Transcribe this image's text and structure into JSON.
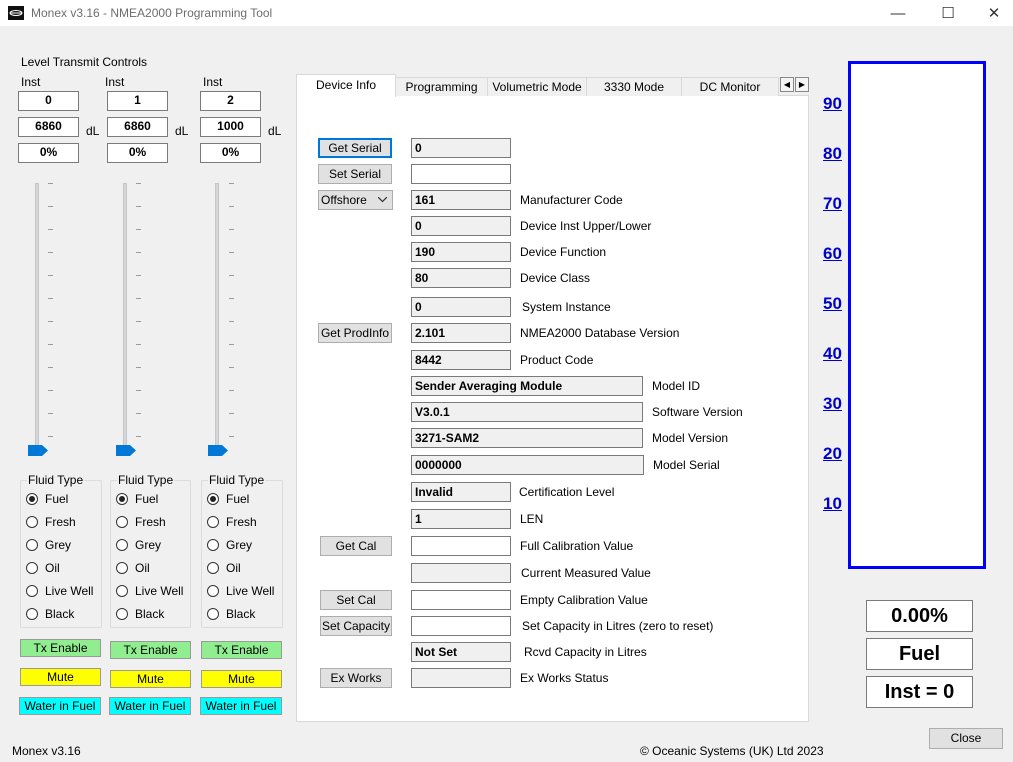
{
  "window": {
    "title": "Monex v3.16 - NMEA2000 Programming Tool",
    "min_glyph": "—",
    "max_glyph": "☐",
    "close_glyph": "✕"
  },
  "level": {
    "title": "Level Transmit Controls",
    "inst_label": "Inst",
    "unit": "dL",
    "fluid_type_label": "Fluid Type",
    "fluid_options": [
      "Fuel",
      "Fresh",
      "Grey",
      "Oil",
      "Live Well",
      "Black"
    ],
    "tx_enable": "Tx Enable",
    "mute": "Mute",
    "water_in_fuel": "Water in Fuel",
    "channels": [
      {
        "inst": "0",
        "value": "6860",
        "percent": "0%",
        "slider_level": 0,
        "selected": "Fuel"
      },
      {
        "inst": "1",
        "value": "6860",
        "percent": "0%",
        "slider_level": 0,
        "selected": "Fuel"
      },
      {
        "inst": "2",
        "value": "1000",
        "percent": "0%",
        "slider_level": 0,
        "selected": "Fuel"
      }
    ]
  },
  "tabs": {
    "items": [
      "Device Info",
      "Programming",
      "Volumetric Mode",
      "3330 Mode",
      "DC Monitor"
    ],
    "active": "Device Info",
    "left_arrow": "◀",
    "right_arrow": "▶"
  },
  "device_info": {
    "buttons": {
      "get_serial": "Get Serial",
      "set_serial": "Set Serial",
      "dropdown": "Offshore",
      "get_prodinfo": "Get ProdInfo",
      "get_cal": "Get Cal",
      "set_cal": "Set Cal",
      "set_capacity": "Set Capacity",
      "ex_works": "Ex Works"
    },
    "serial_value": "0",
    "set_serial_value": "",
    "fields": {
      "manufacturer_code": {
        "value": "161",
        "label": "Manufacturer Code"
      },
      "device_inst": {
        "value": "0",
        "label": "Device Inst Upper/Lower"
      },
      "device_function": {
        "value": "190",
        "label": "Device Function"
      },
      "device_class": {
        "value": "80",
        "label": "Device Class"
      },
      "system_instance": {
        "value": "0",
        "label": "System Instance"
      },
      "db_version": {
        "value": "2.101",
        "label": "NMEA2000 Database Version"
      },
      "product_code": {
        "value": "8442",
        "label": "Product Code"
      },
      "model_id": {
        "value": "Sender Averaging Module",
        "label": "Model ID"
      },
      "software_version": {
        "value": "V3.0.1",
        "label": "Software Version"
      },
      "model_version": {
        "value": "3271-SAM2",
        "label": "Model Version"
      },
      "model_serial": {
        "value": "0000000",
        "label": "Model Serial"
      },
      "cert_level": {
        "value": "Invalid",
        "label": "Certification Level"
      },
      "len": {
        "value": "1",
        "label": "LEN"
      },
      "full_cal": {
        "value": "",
        "label": "Full Calibration Value"
      },
      "current_measured": {
        "value": "",
        "label": "Current Measured Value"
      },
      "empty_cal": {
        "value": "",
        "label": "Empty Calibration Value"
      },
      "set_capacity": {
        "value": "",
        "label": "Set Capacity in Litres (zero to reset)"
      },
      "rcvd_capacity": {
        "value": "Not Set",
        "label": "Rcvd Capacity in Litres"
      },
      "ex_works_status": {
        "value": "",
        "label": "Ex Works Status"
      }
    }
  },
  "tank": {
    "scale": [
      "90",
      "80",
      "70",
      "60",
      "50",
      "40",
      "30",
      "20",
      "10"
    ],
    "fill_level": 0,
    "percent": "0.00%",
    "fluid": "Fuel",
    "inst": "Inst = 0",
    "border_color": "#0000ff"
  },
  "footer": {
    "version": "Monex v3.16",
    "copyright": "© Oceanic Systems (UK) Ltd 2023",
    "close": "Close"
  }
}
